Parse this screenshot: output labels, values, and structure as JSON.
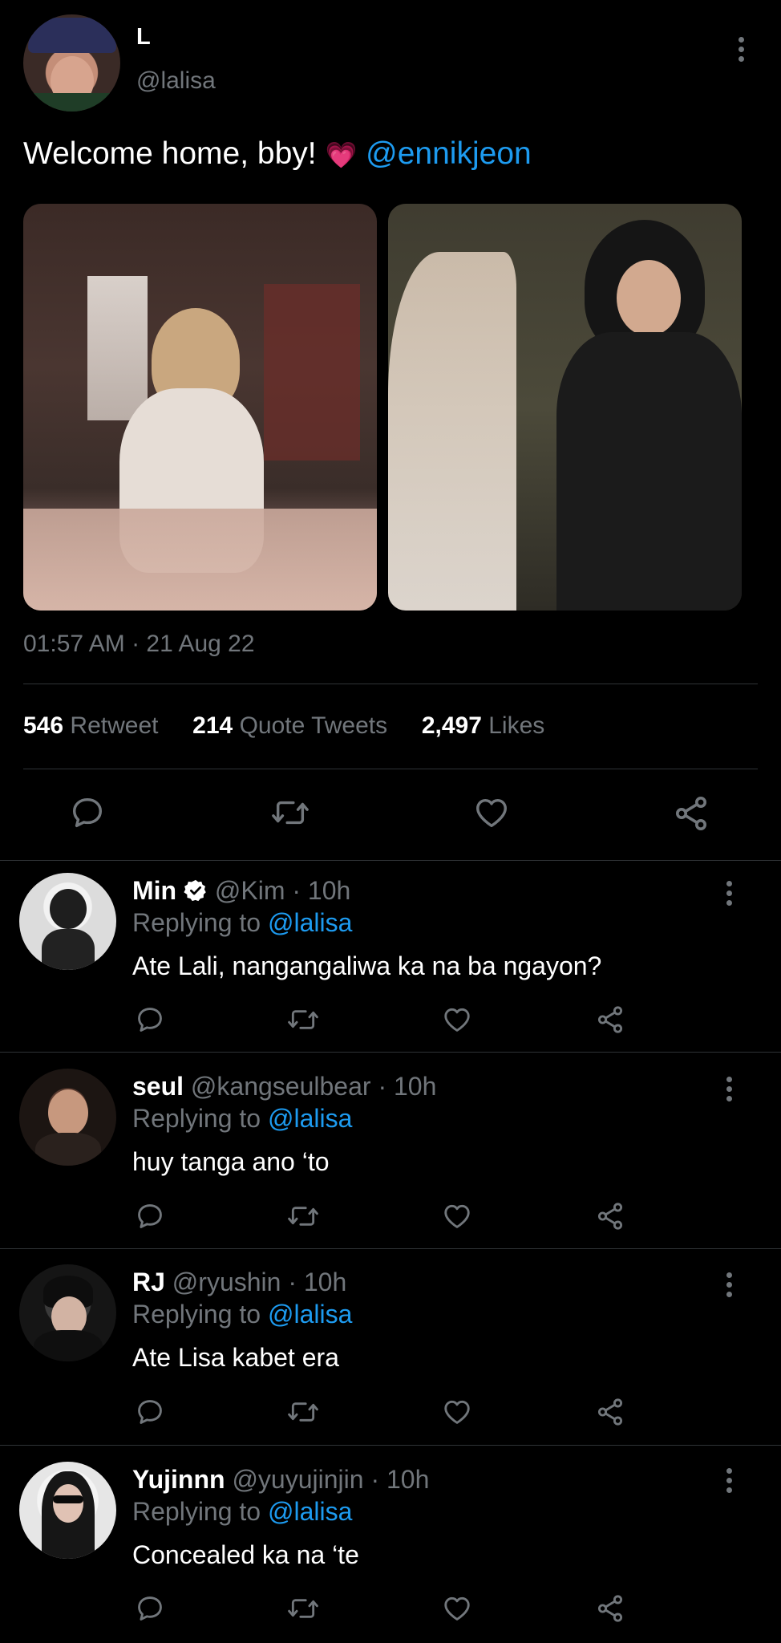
{
  "main_tweet": {
    "display_name": "L",
    "handle": "@lalisa",
    "text": "Welcome home, bby!",
    "emoji": "💗",
    "mention": "@ennikjeon",
    "timestamp": "01:57 AM · 21 Aug 22",
    "stats": {
      "retweets_count": "546",
      "retweets_label": "Retweet",
      "quotes_count": "214",
      "quotes_label": "Quote Tweets",
      "likes_count": "2,497",
      "likes_label": "Likes"
    }
  },
  "replies": [
    {
      "name": "Min",
      "verified": true,
      "handle": "@Kim",
      "time": "· 10h",
      "replying_label": "Replying to",
      "replying_to": "@lalisa",
      "text": "Ate Lali, nangangaliwa ka na ba ngayon?"
    },
    {
      "name": "seul",
      "verified": false,
      "handle": "@kangseulbear",
      "time": "· 10h",
      "replying_label": "Replying to",
      "replying_to": "@lalisa",
      "text": "huy tanga ano ‘to"
    },
    {
      "name": "RJ",
      "verified": false,
      "handle": "@ryushin",
      "time": "· 10h",
      "replying_label": "Replying to",
      "replying_to": "@lalisa",
      "text": "Ate Lisa kabet era"
    },
    {
      "name": "Yujinnn",
      "verified": false,
      "handle": "@yuyujinjin",
      "time": "· 10h",
      "replying_label": "Replying to",
      "replying_to": "@lalisa",
      "text": "Concealed ka na ‘te"
    }
  ],
  "icons": {
    "reply": "reply-icon",
    "retweet": "retweet-icon",
    "like": "heart-icon",
    "share": "share-icon",
    "more": "more-options-icon"
  },
  "colors": {
    "background": "#000000",
    "accent": "#1d9bf0",
    "muted": "#71767b",
    "divider": "#2f3336"
  }
}
